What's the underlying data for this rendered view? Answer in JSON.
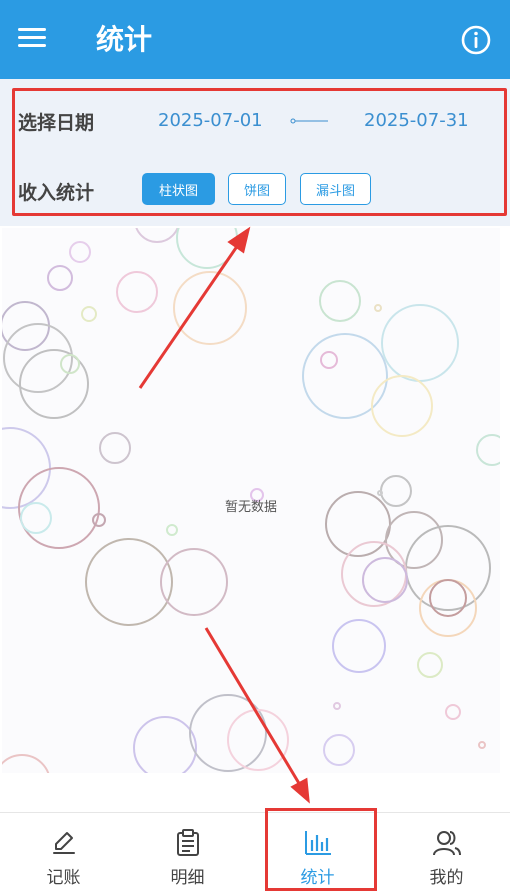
{
  "header": {
    "title": "统计",
    "menu_icon": "hamburger-menu-icon",
    "info_icon": "info-icon",
    "bg_color": "#2b9be3"
  },
  "filters": {
    "date_label": "选择日期",
    "start_date": "2025-07-01",
    "end_date": "2025-07-31",
    "income_label": "收入统计",
    "chart_types": [
      {
        "label": "柱状图",
        "active": true
      },
      {
        "label": "饼图",
        "active": false
      },
      {
        "label": "漏斗图",
        "active": false
      }
    ]
  },
  "chart": {
    "empty_text": "暂无数据"
  },
  "tabs": [
    {
      "label": "记账",
      "icon": "pen-icon",
      "active": false
    },
    {
      "label": "明细",
      "icon": "clipboard-icon",
      "active": false
    },
    {
      "label": "统计",
      "icon": "bar-chart-icon",
      "active": true
    },
    {
      "label": "我的",
      "icon": "users-icon",
      "active": false
    }
  ],
  "colors": {
    "accent": "#2b9be3",
    "highlight": "#e53935"
  }
}
